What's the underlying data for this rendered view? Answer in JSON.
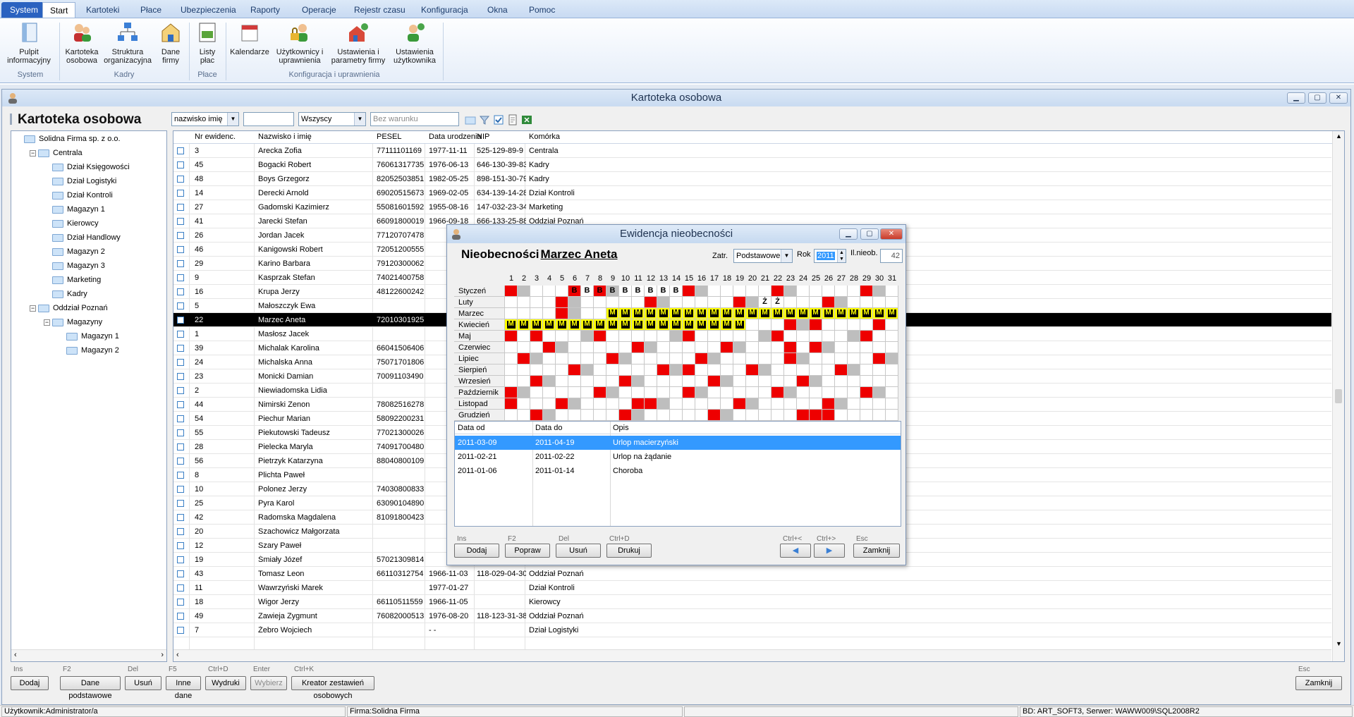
{
  "menu": {
    "system": "System",
    "tabs": [
      "Start",
      "Kartoteki",
      "Płace",
      "Ubezpieczenia",
      "Raporty",
      "Operacje",
      "Rejestr czasu",
      "Konfiguracja",
      "Okna",
      "Pomoc"
    ]
  },
  "ribbon": {
    "buttons": [
      {
        "label1": "Pulpit",
        "label2": "informacyjny",
        "icon": "dashboard-icon"
      },
      {
        "label1": "Kartoteka",
        "label2": "osobowa",
        "icon": "people-icon"
      },
      {
        "label1": "Struktura",
        "label2": "organizacyjna",
        "icon": "org-chart-icon"
      },
      {
        "label1": "Dane",
        "label2": "firmy",
        "icon": "company-icon"
      },
      {
        "label1": "Listy",
        "label2": "płac",
        "icon": "payroll-icon"
      },
      {
        "label1": "Kalendarze",
        "label2": "",
        "icon": "calendar-icon"
      },
      {
        "label1": "Użytkownicy i",
        "label2": "uprawnienia",
        "icon": "users-lock-icon"
      },
      {
        "label1": "Ustawienia i",
        "label2": "parametry firmy",
        "icon": "company-settings-icon"
      },
      {
        "label1": "Ustawienia",
        "label2": "użytkownika",
        "icon": "user-settings-icon"
      }
    ],
    "groups": [
      "System",
      "Kadry",
      "Płace",
      "Konfiguracja i uprawnienia"
    ]
  },
  "kartoteka": {
    "window_title": "Kartoteka osobowa",
    "caption": "Kartoteka osobowa",
    "filter_field": "nazwisko imię",
    "filter_scope": "Wszyscy",
    "filter_condition_placeholder": "Bez warunku",
    "columns": [
      "Nr ewidenc.",
      "Nazwisko i imię",
      "PESEL",
      "Data urodzenia",
      "NIP",
      "Komórka"
    ],
    "rows": [
      [
        "3",
        "Arecka Zofia",
        "77111101169",
        "1977-11-11",
        "525-129-89-9",
        "Centrala"
      ],
      [
        "45",
        "Bogacki Robert",
        "76061317735",
        "1976-06-13",
        "646-130-39-83",
        "Kadry"
      ],
      [
        "48",
        "Boys Grzegorz",
        "82052503851",
        "1982-05-25",
        "898-151-30-79",
        "Kadry"
      ],
      [
        "14",
        "Derecki Arnold",
        "69020515673",
        "1969-02-05",
        "634-139-14-28",
        "Dział Kontroli"
      ],
      [
        "27",
        "Gadomski Kazimierz",
        "55081601592",
        "1955-08-16",
        "147-032-23-34",
        "Marketing"
      ],
      [
        "41",
        "Jarecki Stefan",
        "66091800019",
        "1966-09-18",
        "666-133-25-88",
        "Oddział Poznań"
      ],
      [
        "26",
        "Jordan Jacek",
        "77120707478",
        "",
        "",
        "",
        ""
      ],
      [
        "46",
        "Kanigowski Robert",
        "72051200555",
        "",
        "",
        "",
        ""
      ],
      [
        "29",
        "Karino Barbara",
        "79120300062",
        "",
        "",
        "",
        ""
      ],
      [
        "9",
        "Kasprzak Stefan",
        "74021400758",
        "",
        "",
        "",
        ""
      ],
      [
        "16",
        "Krupa Jerzy",
        "48122600242",
        "",
        "",
        "",
        ""
      ],
      [
        "5",
        "Małoszczyk Ewa",
        "",
        "",
        "",
        "",
        ""
      ],
      [
        "22",
        "Marzec Aneta",
        "72010301925",
        "",
        "",
        "",
        ""
      ],
      [
        "1",
        "Masłosz Jacek",
        "",
        "",
        "",
        "",
        ""
      ],
      [
        "39",
        "Michalak Karolina",
        "66041506406",
        "",
        "",
        "",
        ""
      ],
      [
        "24",
        "Michalska Anna",
        "75071701806",
        "",
        "",
        "",
        ""
      ],
      [
        "23",
        "Monicki Damian",
        "70091103490",
        "",
        "",
        "",
        ""
      ],
      [
        "2",
        "Niewiadomska Lidia",
        "",
        "",
        "",
        "",
        ""
      ],
      [
        "44",
        "Nimirski Zenon",
        "78082516278",
        "",
        "",
        "",
        ""
      ],
      [
        "54",
        "Piechur Marian",
        "58092200231",
        "",
        "",
        "",
        ""
      ],
      [
        "55",
        "Piekutowski Tadeusz",
        "77021300026",
        "",
        "",
        "",
        ""
      ],
      [
        "28",
        "Pielecka Maryla",
        "74091700480",
        "",
        "",
        "",
        ""
      ],
      [
        "56",
        "Pietrzyk Katarzyna",
        "88040800109",
        "",
        "",
        "",
        ""
      ],
      [
        "8",
        "Plichta Paweł",
        "",
        "",
        "",
        "",
        ""
      ],
      [
        "10",
        "Polonez Jerzy",
        "74030800833",
        "",
        "",
        "",
        ""
      ],
      [
        "25",
        "Pyra Karol",
        "63090104890",
        "",
        "",
        "",
        ""
      ],
      [
        "42",
        "Radomska Magdalena",
        "81091800423",
        "",
        "",
        "",
        ""
      ],
      [
        "20",
        "Szachowicz Małgorzata",
        "",
        "",
        "",
        "",
        ""
      ],
      [
        "12",
        "Szary Paweł",
        "",
        "",
        "",
        "",
        ""
      ],
      [
        "19",
        "Śmiały Józef",
        "57021309814",
        "",
        "",
        "",
        ""
      ],
      [
        "43",
        "Tomasz Leon",
        "66110312754",
        "1966-11-03",
        "118-029-04-30",
        "Oddział Poznań"
      ],
      [
        "11",
        "Wawrzyński Marek",
        "",
        "1977-01-27",
        "",
        "Dział Kontroli"
      ],
      [
        "18",
        "Wigor Jerzy",
        "66110511559",
        "1966-11-05",
        "",
        "Kierowcy"
      ],
      [
        "49",
        "Zawieja Zygmunt",
        "76082000513",
        "1976-08-20",
        "118-123-31-38",
        "Oddział Poznań"
      ],
      [
        "7",
        "Żebro Wojciech",
        "",
        "- -",
        "",
        "Dział Logistyki"
      ]
    ],
    "selected_row": 12,
    "tree": [
      {
        "label": "Solidna Firma sp. z o.o.",
        "level": 0
      },
      {
        "label": "Centrala",
        "level": 1,
        "expander": "-"
      },
      {
        "label": "Dział Księgowości",
        "level": 2
      },
      {
        "label": "Dział Logistyki",
        "level": 2
      },
      {
        "label": "Dział Kontroli",
        "level": 2
      },
      {
        "label": "Magazyn 1",
        "level": 2
      },
      {
        "label": "Kierowcy",
        "level": 2
      },
      {
        "label": "Dział Handlowy",
        "level": 2
      },
      {
        "label": "Magazyn 2",
        "level": 2
      },
      {
        "label": "Magazyn 3",
        "level": 2
      },
      {
        "label": "Marketing",
        "level": 2
      },
      {
        "label": "Kadry",
        "level": 2
      },
      {
        "label": "Oddział Poznań",
        "level": 1,
        "expander": "-"
      },
      {
        "label": "Magazyny",
        "level": 2,
        "expander": "-"
      },
      {
        "label": "Magazyn 1",
        "level": 3
      },
      {
        "label": "Magazyn 2",
        "level": 3
      }
    ],
    "buttons": [
      {
        "key": "Ins",
        "label": "Dodaj"
      },
      {
        "key": "F2",
        "label": "Dane podstawowe"
      },
      {
        "key": "Del",
        "label": "Usuń"
      },
      {
        "key": "F5",
        "label": "Inne dane"
      },
      {
        "key": "Ctrl+D",
        "label": "Wydruki"
      },
      {
        "key": "Enter",
        "label": "Wybierz"
      },
      {
        "key": "Ctrl+K",
        "label": "Kreator zestawień osobowych"
      }
    ],
    "close": {
      "key": "Esc",
      "label": "Zamknij"
    }
  },
  "dialog": {
    "title": "Ewidencja nieobecności",
    "caption_prefix": "Nieobecności",
    "employee": "Marzec Aneta",
    "zatr_label": "Zatr.",
    "zatr_value": "Podstawowe",
    "rok_label": "Rok",
    "rok_value": "2011",
    "il_label": "Il.nieob.",
    "il_value": "42",
    "months": [
      "Styczeń",
      "Luty",
      "Marzec",
      "Kwiecień",
      "Maj",
      "Czerwiec",
      "Lipiec",
      "Sierpień",
      "Wrzesień",
      "Październik",
      "Listopad",
      "Grudzień"
    ],
    "list_columns": [
      "Data od",
      "Data do",
      "Opis"
    ],
    "list_rows": [
      [
        "2011-03-09",
        "2011-04-19",
        "Urlop macierzyński"
      ],
      [
        "2011-02-21",
        "2011-02-22",
        "Urlop na żądanie"
      ],
      [
        "2011-01-06",
        "2011-01-14",
        "Choroba"
      ]
    ],
    "buttons": [
      {
        "key": "Ins",
        "label": "Dodaj"
      },
      {
        "key": "F2",
        "label": "Popraw"
      },
      {
        "key": "Del",
        "label": "Usuń"
      },
      {
        "key": "Ctrl+D",
        "label": "Drukuj"
      }
    ],
    "nav": {
      "prev_key": "Ctrl+<",
      "next_key": "Ctrl+>",
      "close_key": "Esc",
      "close_label": "Zamknij"
    },
    "calendar": {
      "weekend": {
        "0": [
          1,
          2,
          8,
          9,
          15,
          16,
          22,
          23,
          29,
          30
        ],
        "1": [
          5,
          6,
          12,
          13,
          19,
          20,
          26,
          27
        ],
        "2": [
          5,
          6,
          12,
          13,
          19,
          20,
          26,
          27
        ],
        "3": [
          2,
          3,
          9,
          10,
          16,
          17,
          23,
          24,
          30
        ],
        "4": [
          1,
          7,
          8,
          14,
          15,
          21,
          22,
          28,
          29
        ],
        "5": [
          4,
          5,
          11,
          12,
          18,
          19,
          25,
          26
        ],
        "6": [
          2,
          3,
          9,
          10,
          16,
          17,
          23,
          24,
          30,
          31
        ],
        "7": [
          6,
          7,
          13,
          14,
          20,
          21,
          27,
          28
        ],
        "8": [
          3,
          4,
          10,
          11,
          17,
          18,
          24,
          25
        ],
        "9": [
          1,
          2,
          8,
          9,
          15,
          16,
          22,
          23,
          29,
          30
        ],
        "10": [
          5,
          6,
          12,
          13,
          19,
          20,
          26,
          27
        ],
        "11": [
          3,
          4,
          10,
          11,
          17,
          18,
          24,
          25
        ]
      },
      "holidays": {
        "0": [
          1,
          6
        ],
        "3": [
          25
        ],
        "4": [
          3
        ],
        "5": [
          23
        ],
        "7": [
          15
        ],
        "10": [
          1,
          11
        ],
        "11": [
          25,
          26
        ]
      },
      "absence_codes": {
        "0": {
          "6": "B",
          "7": "B",
          "8": "B",
          "9": "B",
          "10": "B",
          "11": "B",
          "12": "B",
          "13": "B",
          "14": "B"
        },
        "1": {
          "21": "Ż",
          "22": "Ż"
        },
        "2": {
          "9": "M",
          "10": "M",
          "11": "M",
          "12": "M",
          "13": "M",
          "14": "M",
          "15": "M",
          "16": "M",
          "17": "M",
          "18": "M",
          "19": "M",
          "20": "M",
          "21": "M",
          "22": "M",
          "23": "M",
          "24": "M",
          "25": "M",
          "26": "M",
          "27": "M",
          "28": "M",
          "29": "M",
          "30": "M",
          "31": "M"
        },
        "3": {
          "1": "M",
          "2": "M",
          "3": "M",
          "4": "M",
          "5": "M",
          "6": "M",
          "7": "M",
          "8": "M",
          "9": "M",
          "10": "M",
          "11": "M",
          "12": "M",
          "13": "M",
          "14": "M",
          "15": "M",
          "16": "M",
          "17": "M",
          "18": "M",
          "19": "M"
        }
      },
      "month_lengths": [
        31,
        28,
        31,
        30,
        31,
        30,
        31,
        31,
        30,
        31,
        30,
        31
      ]
    }
  },
  "status": {
    "user": "Użytkownik:Administrator/a",
    "firm": "Firma:Solidna Firma",
    "db": "BD: ART_SOFT3, Serwer: WAWW009\\SQL2008R2"
  },
  "colors": {
    "accent": "#2a62c0",
    "absence": "#ee0000",
    "weekend": "#bebebe",
    "maternity": "#ffff00",
    "selection": "#3399ff"
  }
}
